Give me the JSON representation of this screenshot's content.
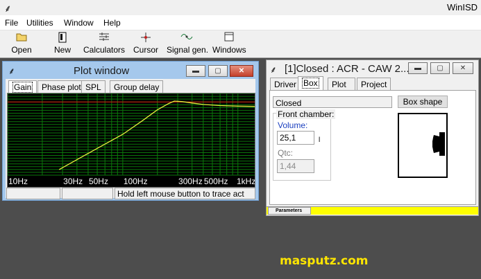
{
  "app": {
    "title": "WinISD",
    "logo_glyph": "⸙"
  },
  "menu": [
    "File",
    "Utilities",
    "Window",
    "Help"
  ],
  "toolbar": [
    {
      "label": "Open",
      "icon": "folder-icon"
    },
    {
      "label": "New",
      "icon": "new-document-icon"
    },
    {
      "label": "Calculators",
      "icon": "calculator-icon"
    },
    {
      "label": "Cursor",
      "icon": "crosshair-cursor-icon"
    },
    {
      "label": "Signal gen.",
      "icon": "signal-generator-icon"
    },
    {
      "label": "Windows",
      "icon": "windows-icon"
    }
  ],
  "plot_window": {
    "title": "Plot window",
    "tabs": [
      "Gain",
      "Phase plot",
      "SPL",
      "Group delay"
    ],
    "active_tab": "Gain",
    "x_labels": [
      "10Hz",
      "30Hz",
      "50Hz",
      "100Hz",
      "300Hz",
      "500Hz",
      "1kHz"
    ],
    "status": {
      "cell1": "",
      "cell2": "",
      "hint": "Hold left mouse button to trace act"
    }
  },
  "box_window": {
    "title": "[1]Closed : ACR - CAW 2...",
    "tabs": [
      "Driver",
      "Box",
      "Plot",
      "Project"
    ],
    "active_tab": "Box",
    "box_type": "Closed",
    "box_shape_button": "Box shape",
    "front_chamber_label": "Front chamber:",
    "volume_label": "Volume:",
    "volume_value": "25,1",
    "volume_unit": "l",
    "qtc_label": "Qtc:",
    "qtc_value": "1,44",
    "parameters_label": "Parameters"
  },
  "window_buttons": {
    "minimize": "▬",
    "restore": "▢",
    "close": "✕"
  },
  "watermark": "masputz.com",
  "colors": {
    "plot_bg": "#000000",
    "grid": "#0b7a0b",
    "curve": "#e5ef3c",
    "reference": "#e01010",
    "progress": "#ffff00"
  },
  "chart_data": {
    "type": "line",
    "x_scale": "log",
    "xlim": [
      10,
      1400
    ],
    "x_tick_labels": [
      "10Hz",
      "30Hz",
      "50Hz",
      "100Hz",
      "300Hz",
      "500Hz",
      "1kHz"
    ],
    "series": [
      {
        "x": [
          28,
          40,
          60,
          100,
          150,
          200,
          250,
          280,
          330,
          400,
          500,
          700,
          1000,
          1400
        ],
        "y": [
          -24.0,
          -20.5,
          -16.5,
          -11.5,
          -6.5,
          -2.8,
          -0.6,
          0.3,
          0.1,
          -0.4,
          -0.9,
          -1.3,
          -1.5,
          -1.6
        ]
      }
    ],
    "reference_line": 0,
    "ylim": [
      -26,
      3
    ],
    "grid": true
  }
}
